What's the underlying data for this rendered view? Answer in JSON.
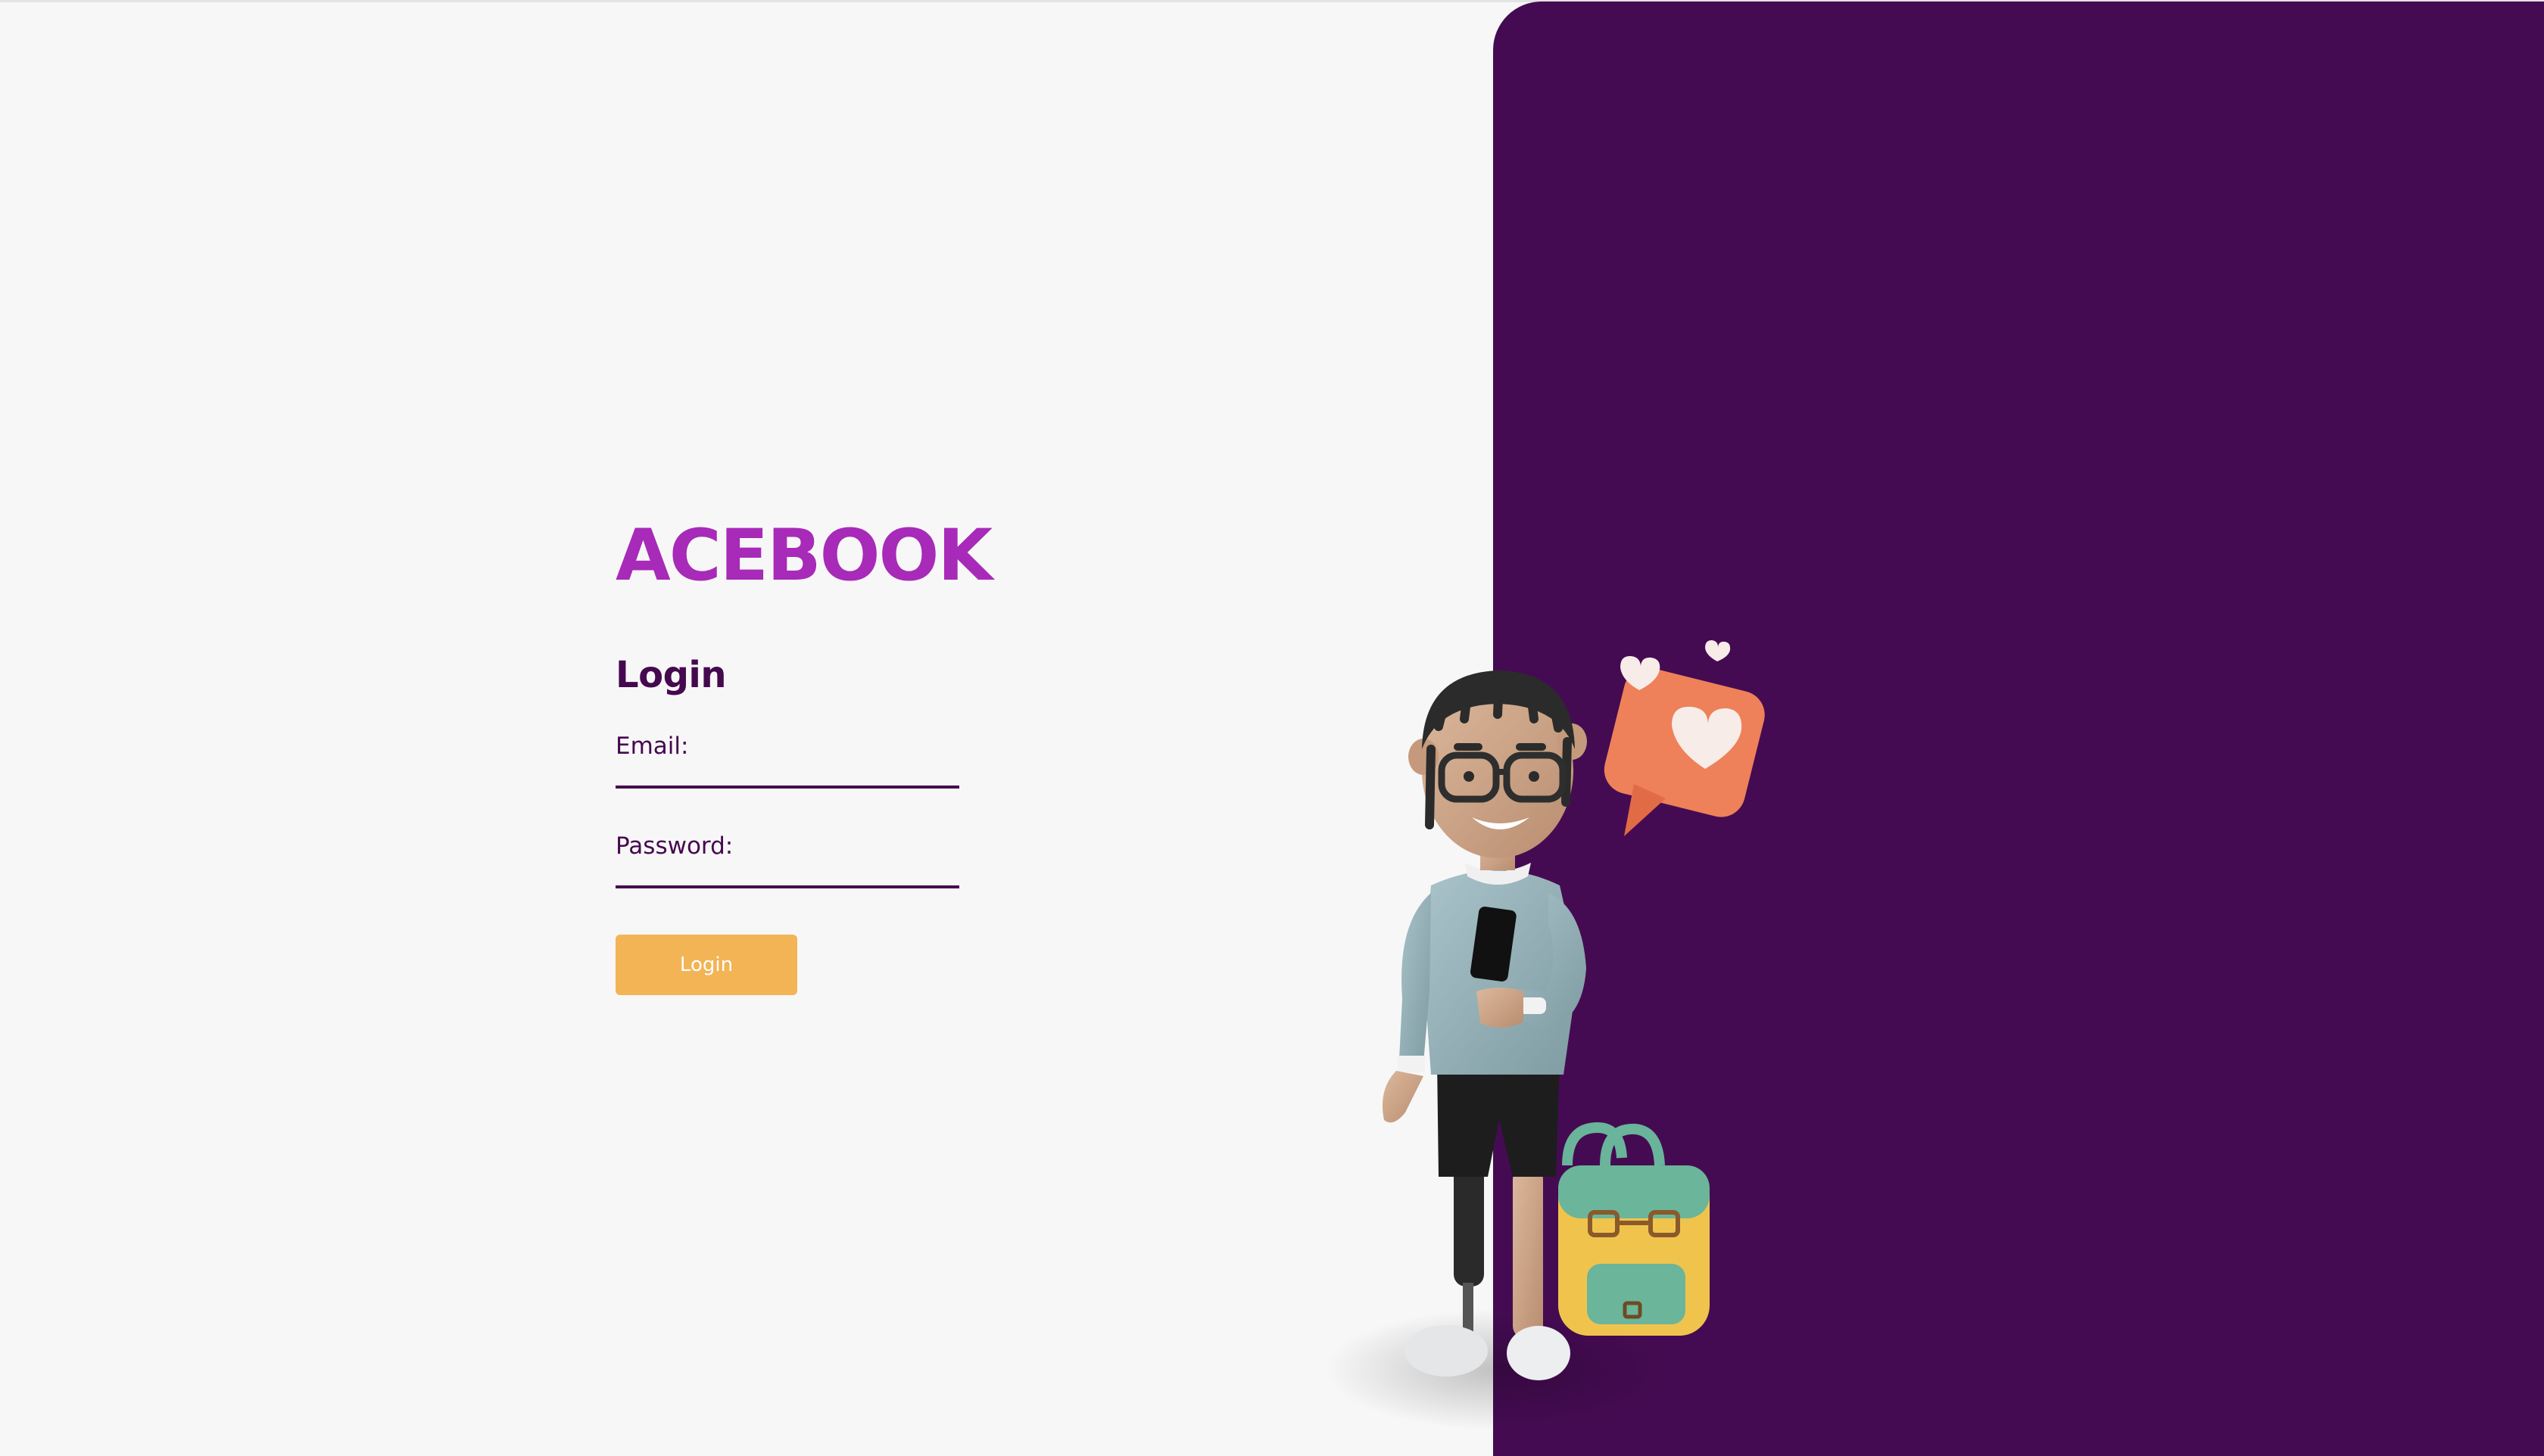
{
  "app": {
    "title": "ACEBOOK"
  },
  "login_form": {
    "heading": "Login",
    "email_label": "Email:",
    "email_value": "",
    "password_label": "Password:",
    "password_value": "",
    "submit_label": "Login"
  },
  "colors": {
    "brand_accent": "#a72ab8",
    "panel_background": "#450b52",
    "text_primary": "#45094f",
    "button_background": "#f3b455",
    "page_background": "#f7f7f7"
  },
  "illustration": {
    "icons": [
      "person-with-phone-icon",
      "heart-notification-icon",
      "backpack-icon"
    ]
  }
}
